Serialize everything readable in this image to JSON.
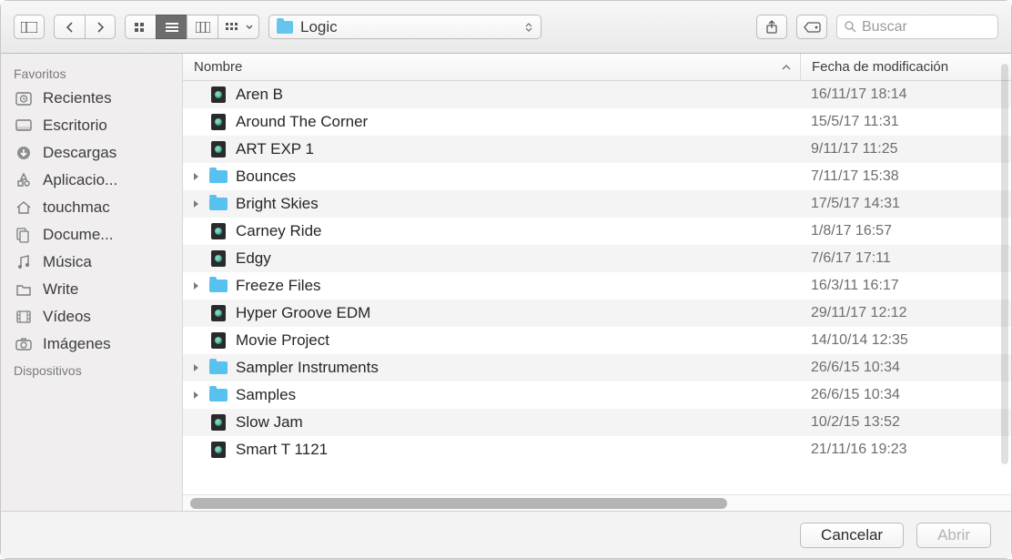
{
  "toolbar": {
    "path_label": "Logic",
    "search_placeholder": "Buscar"
  },
  "sidebar": {
    "sections": [
      {
        "title": "Favoritos",
        "items": [
          {
            "icon": "clock",
            "label": "Recientes"
          },
          {
            "icon": "desktop",
            "label": "Escritorio"
          },
          {
            "icon": "download",
            "label": "Descargas"
          },
          {
            "icon": "apps",
            "label": "Aplicacio..."
          },
          {
            "icon": "home",
            "label": "touchmac"
          },
          {
            "icon": "doc",
            "label": "Docume..."
          },
          {
            "icon": "music",
            "label": "Música"
          },
          {
            "icon": "folder",
            "label": "Write"
          },
          {
            "icon": "film",
            "label": "Vídeos"
          },
          {
            "icon": "camera",
            "label": "Imágenes"
          }
        ]
      },
      {
        "title": "Dispositivos",
        "items": []
      }
    ]
  },
  "columns": {
    "name": "Nombre",
    "date": "Fecha de modificación"
  },
  "rows": [
    {
      "type": "file",
      "name": "Aren B",
      "date": "16/11/17 18:14"
    },
    {
      "type": "file",
      "name": "Around The Corner",
      "date": "15/5/17 11:31"
    },
    {
      "type": "file",
      "name": "ART EXP 1",
      "date": "9/11/17 11:25"
    },
    {
      "type": "folder",
      "name": "Bounces",
      "date": "7/11/17 15:38"
    },
    {
      "type": "folder",
      "name": "Bright Skies",
      "date": "17/5/17 14:31"
    },
    {
      "type": "file",
      "name": "Carney Ride",
      "date": "1/8/17 16:57"
    },
    {
      "type": "file",
      "name": "Edgy",
      "date": "7/6/17 17:11"
    },
    {
      "type": "folder",
      "name": "Freeze Files",
      "date": "16/3/11 16:17"
    },
    {
      "type": "file",
      "name": "Hyper Groove EDM",
      "date": "29/11/17 12:12"
    },
    {
      "type": "file",
      "name": "Movie Project",
      "date": "14/10/14 12:35"
    },
    {
      "type": "folder",
      "name": "Sampler Instruments",
      "date": "26/6/15 10:34"
    },
    {
      "type": "folder",
      "name": "Samples",
      "date": "26/6/15 10:34"
    },
    {
      "type": "file",
      "name": "Slow Jam",
      "date": "10/2/15 13:52"
    },
    {
      "type": "file",
      "name": "Smart T 1121",
      "date": "21/11/16 19:23"
    }
  ],
  "footer": {
    "cancel": "Cancelar",
    "open": "Abrir"
  }
}
